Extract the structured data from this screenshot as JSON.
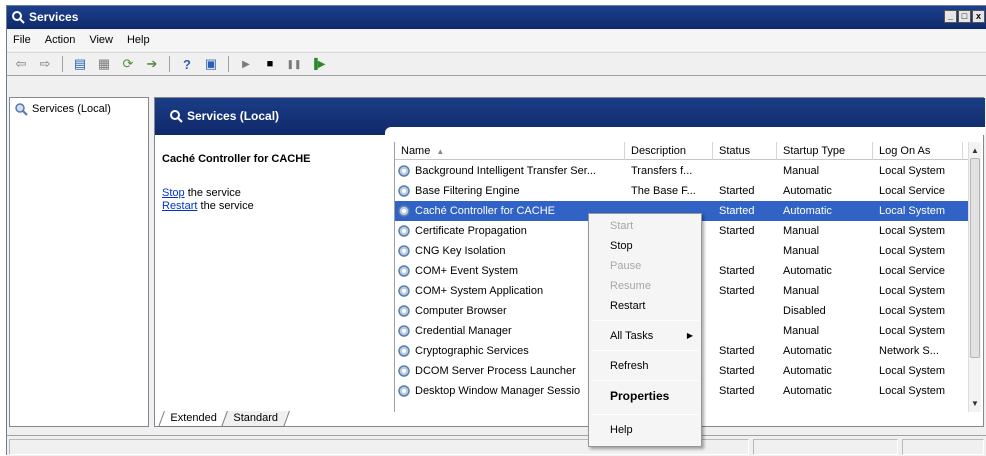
{
  "window": {
    "title": "Services",
    "controls": [
      "minimize",
      "maximize",
      "close"
    ]
  },
  "menu": [
    "File",
    "Action",
    "View",
    "Help"
  ],
  "toolbar": {
    "buttons": [
      {
        "name": "back-icon",
        "glyph": "⇦"
      },
      {
        "name": "forward-icon",
        "glyph": "⇨"
      },
      {
        "name": "show-hide-tree-icon",
        "glyph": "▤"
      },
      {
        "name": "properties-icon",
        "glyph": "▦"
      },
      {
        "name": "refresh-icon",
        "glyph": "⟳"
      },
      {
        "name": "export-icon",
        "glyph": "➔"
      },
      {
        "name": "help-icon",
        "glyph": "?"
      },
      {
        "name": "view-icon",
        "glyph": "▣"
      },
      {
        "name": "start-service-icon",
        "glyph": "▶"
      },
      {
        "name": "stop-service-icon",
        "glyph": "■"
      },
      {
        "name": "pause-service-icon",
        "glyph": "❚❚"
      },
      {
        "name": "restart-service-icon",
        "glyph": "▐▶"
      }
    ]
  },
  "tree": {
    "item": "Services (Local)"
  },
  "panel": {
    "header": "Services (Local)"
  },
  "description": {
    "service_name": "Caché Controller for CACHE",
    "stop_link": "Stop",
    "stop_suffix": " the service",
    "restart_link": "Restart",
    "restart_suffix": " the service"
  },
  "list": {
    "columns": [
      "Name",
      "Description",
      "Status",
      "Startup Type",
      "Log On As"
    ],
    "rows": [
      {
        "name": "Background Intelligent Transfer Ser...",
        "description": "Transfers f...",
        "status": "",
        "startup": "Manual",
        "logon": "Local System"
      },
      {
        "name": "Base Filtering Engine",
        "description": "The Base F...",
        "status": "Started",
        "startup": "Automatic",
        "logon": "Local Service"
      },
      {
        "name": "Caché Controller for CACHE",
        "description": "",
        "status": "Started",
        "startup": "Automatic",
        "logon": "Local System",
        "selected": true
      },
      {
        "name": "Certificate Propagation",
        "description": "",
        "status": "Started",
        "startup": "Manual",
        "logon": "Local System"
      },
      {
        "name": "CNG Key Isolation",
        "description": "",
        "status": "",
        "startup": "Manual",
        "logon": "Local System"
      },
      {
        "name": "COM+ Event System",
        "description": "",
        "status": "Started",
        "startup": "Automatic",
        "logon": "Local Service"
      },
      {
        "name": "COM+ System Application",
        "description": "",
        "status": "Started",
        "startup": "Manual",
        "logon": "Local System"
      },
      {
        "name": "Computer Browser",
        "description": "",
        "status": "",
        "startup": "Disabled",
        "logon": "Local System"
      },
      {
        "name": "Credential Manager",
        "description": "",
        "status": "",
        "startup": "Manual",
        "logon": "Local System"
      },
      {
        "name": "Cryptographic Services",
        "description": "",
        "status": "Started",
        "startup": "Automatic",
        "logon": "Network S..."
      },
      {
        "name": "DCOM Server Process Launcher",
        "description": "",
        "status": "Started",
        "startup": "Automatic",
        "logon": "Local System"
      },
      {
        "name": "Desktop Window Manager Sessio",
        "description": "",
        "status": "Started",
        "startup": "Automatic",
        "logon": "Local System"
      }
    ]
  },
  "tabs": [
    "Extended",
    "Standard"
  ],
  "context_menu": [
    {
      "label": "Start",
      "disabled": true
    },
    {
      "label": "Stop",
      "disabled": false
    },
    {
      "label": "Pause",
      "disabled": true
    },
    {
      "label": "Resume",
      "disabled": true
    },
    {
      "label": "Restart",
      "disabled": false
    },
    {
      "separator": true
    },
    {
      "label": "All Tasks",
      "submenu": true
    },
    {
      "separator": true
    },
    {
      "label": "Refresh"
    },
    {
      "separator": true
    },
    {
      "label": "Properties",
      "bold": true
    },
    {
      "separator": true
    },
    {
      "label": "Help"
    }
  ]
}
